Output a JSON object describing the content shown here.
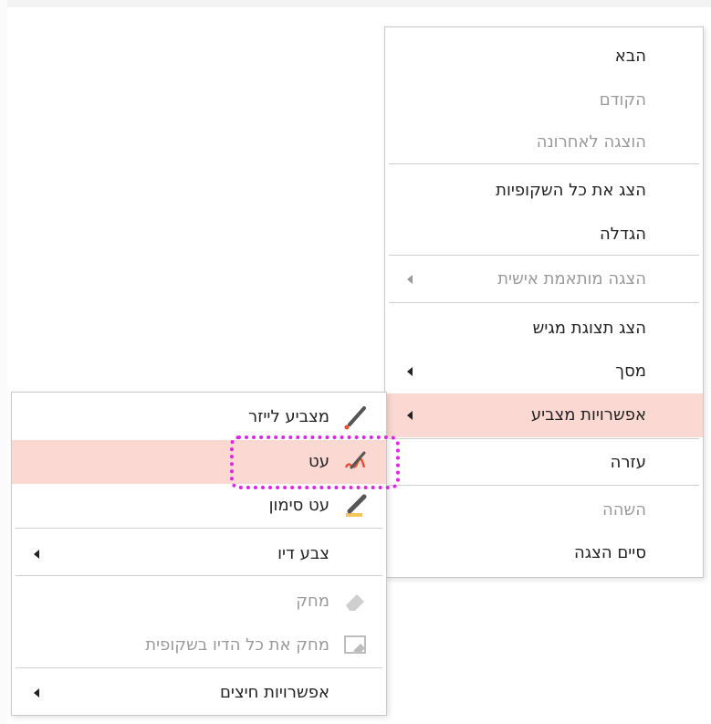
{
  "main_menu": {
    "items": [
      {
        "label": "הבא",
        "disabled": false
      },
      {
        "label": "הקודם",
        "disabled": true
      },
      {
        "label": "הוצגה לאחרונה",
        "disabled": true
      },
      {
        "label": "הצג את כל השקופיות",
        "disabled": false
      },
      {
        "label": "הגדלה",
        "disabled": false
      },
      {
        "label": "הצגה מותאמת אישית",
        "disabled": true,
        "submenu": true
      },
      {
        "label": "הצג תצוגת מגיש",
        "disabled": false
      },
      {
        "label": "מסך",
        "disabled": false,
        "submenu": true
      },
      {
        "label": "אפשרויות מצביע",
        "disabled": false,
        "submenu": true,
        "highlighted": true
      },
      {
        "label": "עזרה",
        "disabled": false
      },
      {
        "label": "השהה",
        "disabled": true
      },
      {
        "label": "סיים הצגה",
        "disabled": false
      }
    ]
  },
  "pointer_submenu": {
    "items": [
      {
        "label": "מצביע לייזר",
        "icon": "laser-pointer-icon",
        "disabled": false
      },
      {
        "label": "עט",
        "icon": "pen-icon",
        "disabled": false,
        "highlighted": true
      },
      {
        "label": "עט סימון",
        "icon": "highlighter-icon",
        "disabled": false
      },
      {
        "label": "צבע דיו",
        "disabled": false,
        "submenu": true
      },
      {
        "label": "מחק",
        "icon": "eraser-icon",
        "disabled": true
      },
      {
        "label": "מחק את כל הדיו בשקופית",
        "icon": "erase-all-ink-icon",
        "disabled": true
      },
      {
        "label": "אפשרויות חיצים",
        "disabled": false,
        "submenu": true
      }
    ]
  },
  "colors": {
    "highlight_bg": "#fbd9d2",
    "focus_outline": "#e023e9",
    "pen_accent": "#e8502f",
    "highlighter_accent": "#f2c65a"
  }
}
